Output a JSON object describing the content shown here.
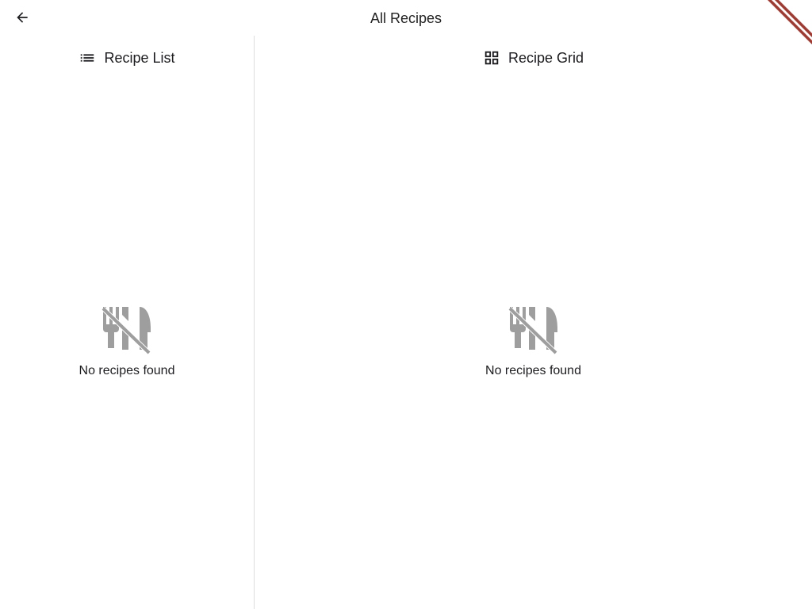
{
  "app": {
    "title": "All Recipes",
    "back_icon": "arrow-back-icon",
    "debug_banner_color": "#a33a32"
  },
  "list_pane": {
    "header_label": "Recipe List",
    "header_icon": "list-icon",
    "empty_icon": "no-food-icon",
    "empty_text": "No recipes found"
  },
  "grid_pane": {
    "header_label": "Recipe Grid",
    "header_icon": "grid-view-icon",
    "empty_icon": "no-food-icon",
    "empty_text": "No recipes found"
  },
  "colors": {
    "empty_icon": "#9e9e9e",
    "divider": "#dcdcdc",
    "text": "#1c1b1f"
  }
}
